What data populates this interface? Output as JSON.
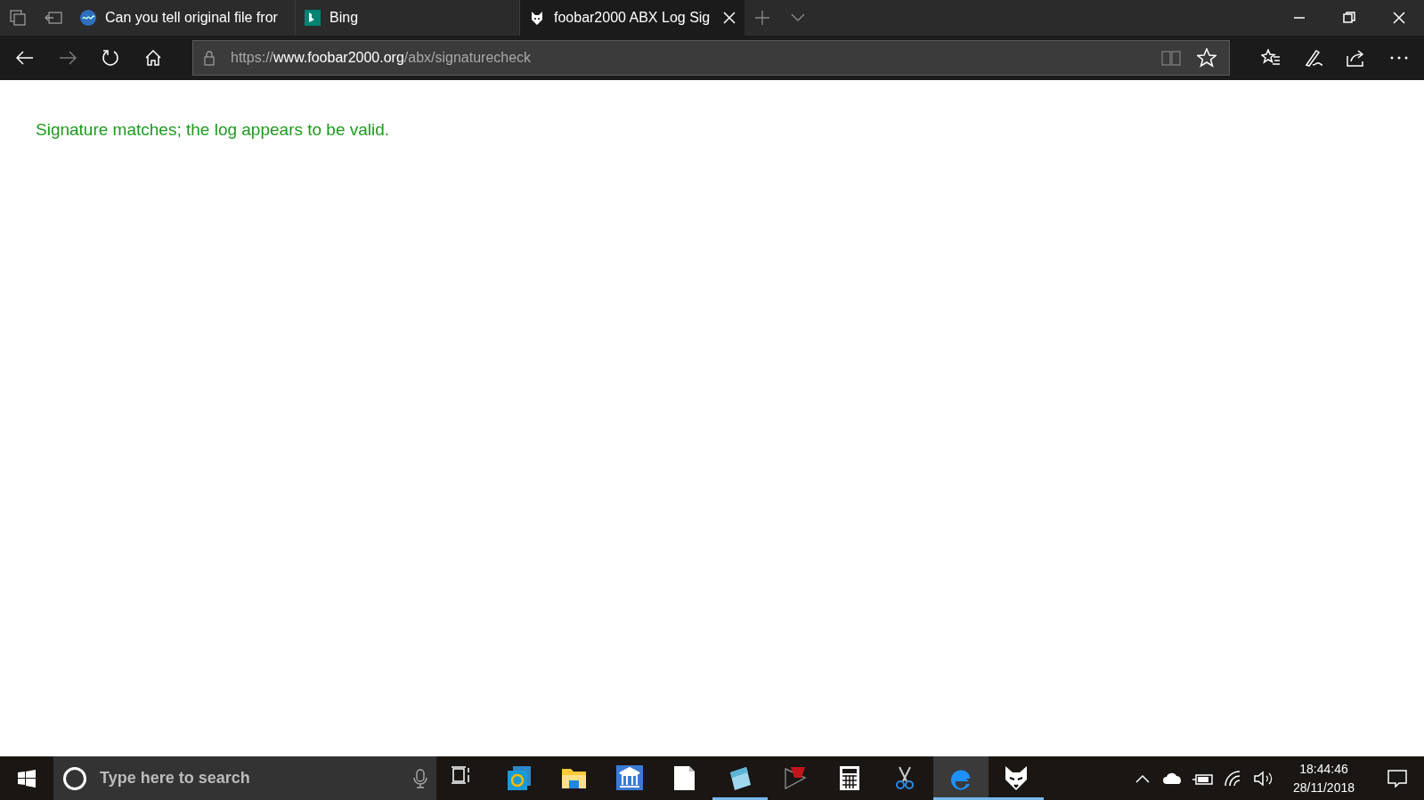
{
  "browser_tabs": [
    {
      "title": "Can you tell original file fror",
      "kind": "wave",
      "selected": false
    },
    {
      "title": "Bing",
      "kind": "bing",
      "selected": false
    },
    {
      "title": "foobar2000 ABX Log Sig",
      "kind": "fox",
      "selected": true
    }
  ],
  "address_bar": {
    "scheme": "https://",
    "host": "www.foobar2000.org",
    "path": "/abx/signaturecheck"
  },
  "page": {
    "message": "Signature matches; the log appears to be valid."
  },
  "taskbar": {
    "search": {
      "placeholder": "Type here to search"
    },
    "apps": [
      {
        "kind": "taskview",
        "running": false,
        "active": false
      },
      {
        "kind": "sync",
        "running": false,
        "active": false
      },
      {
        "kind": "folder",
        "running": false,
        "active": false
      },
      {
        "kind": "bank",
        "running": false,
        "active": false
      },
      {
        "kind": "document",
        "running": false,
        "active": false
      },
      {
        "kind": "notepad",
        "running": true,
        "active": false
      },
      {
        "kind": "redapp",
        "running": false,
        "active": false
      },
      {
        "kind": "calculator",
        "running": false,
        "active": false
      },
      {
        "kind": "scissors",
        "running": false,
        "active": false
      },
      {
        "kind": "browser",
        "running": true,
        "active": true
      },
      {
        "kind": "fox",
        "running": true,
        "active": false
      }
    ],
    "clock": {
      "time": "18:44:46",
      "date": "28/11/2018"
    }
  }
}
